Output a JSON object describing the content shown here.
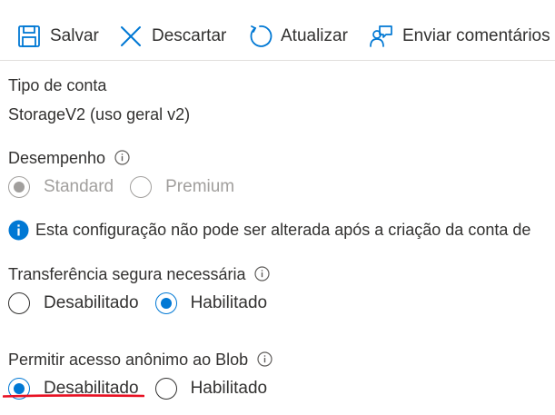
{
  "toolbar": {
    "save_label": "Salvar",
    "discard_label": "Descartar",
    "refresh_label": "Atualizar",
    "feedback_label": "Enviar comentários"
  },
  "account_type": {
    "label": "Tipo de conta",
    "value": "StorageV2 (uso geral v2)"
  },
  "performance": {
    "label": "Desempenho",
    "options": [
      "Standard",
      "Premium"
    ],
    "selected": "Standard",
    "disabled": true
  },
  "notice": {
    "text": "Esta configuração não pode ser alterada após a criação da conta de"
  },
  "secure_transfer": {
    "label": "Transferência segura necessária",
    "options": [
      "Desabilitado",
      "Habilitado"
    ],
    "selected": "Habilitado"
  },
  "blob_anonymous_access": {
    "label": "Permitir acesso anônimo ao Blob",
    "options": [
      "Desabilitado",
      "Habilitado"
    ],
    "selected": "Desabilitado",
    "highlighted_option": "Desabilitado"
  },
  "colors": {
    "accent": "#0078d4",
    "text": "#323130",
    "disabled": "#a19f9d",
    "highlight_underline": "#e81123",
    "divider": "#e1dfdd"
  },
  "icons": {
    "save": "save-icon",
    "discard": "close-icon",
    "refresh": "refresh-icon",
    "feedback": "feedback-icon",
    "info": "info-icon",
    "notice": "info-filled-icon"
  }
}
